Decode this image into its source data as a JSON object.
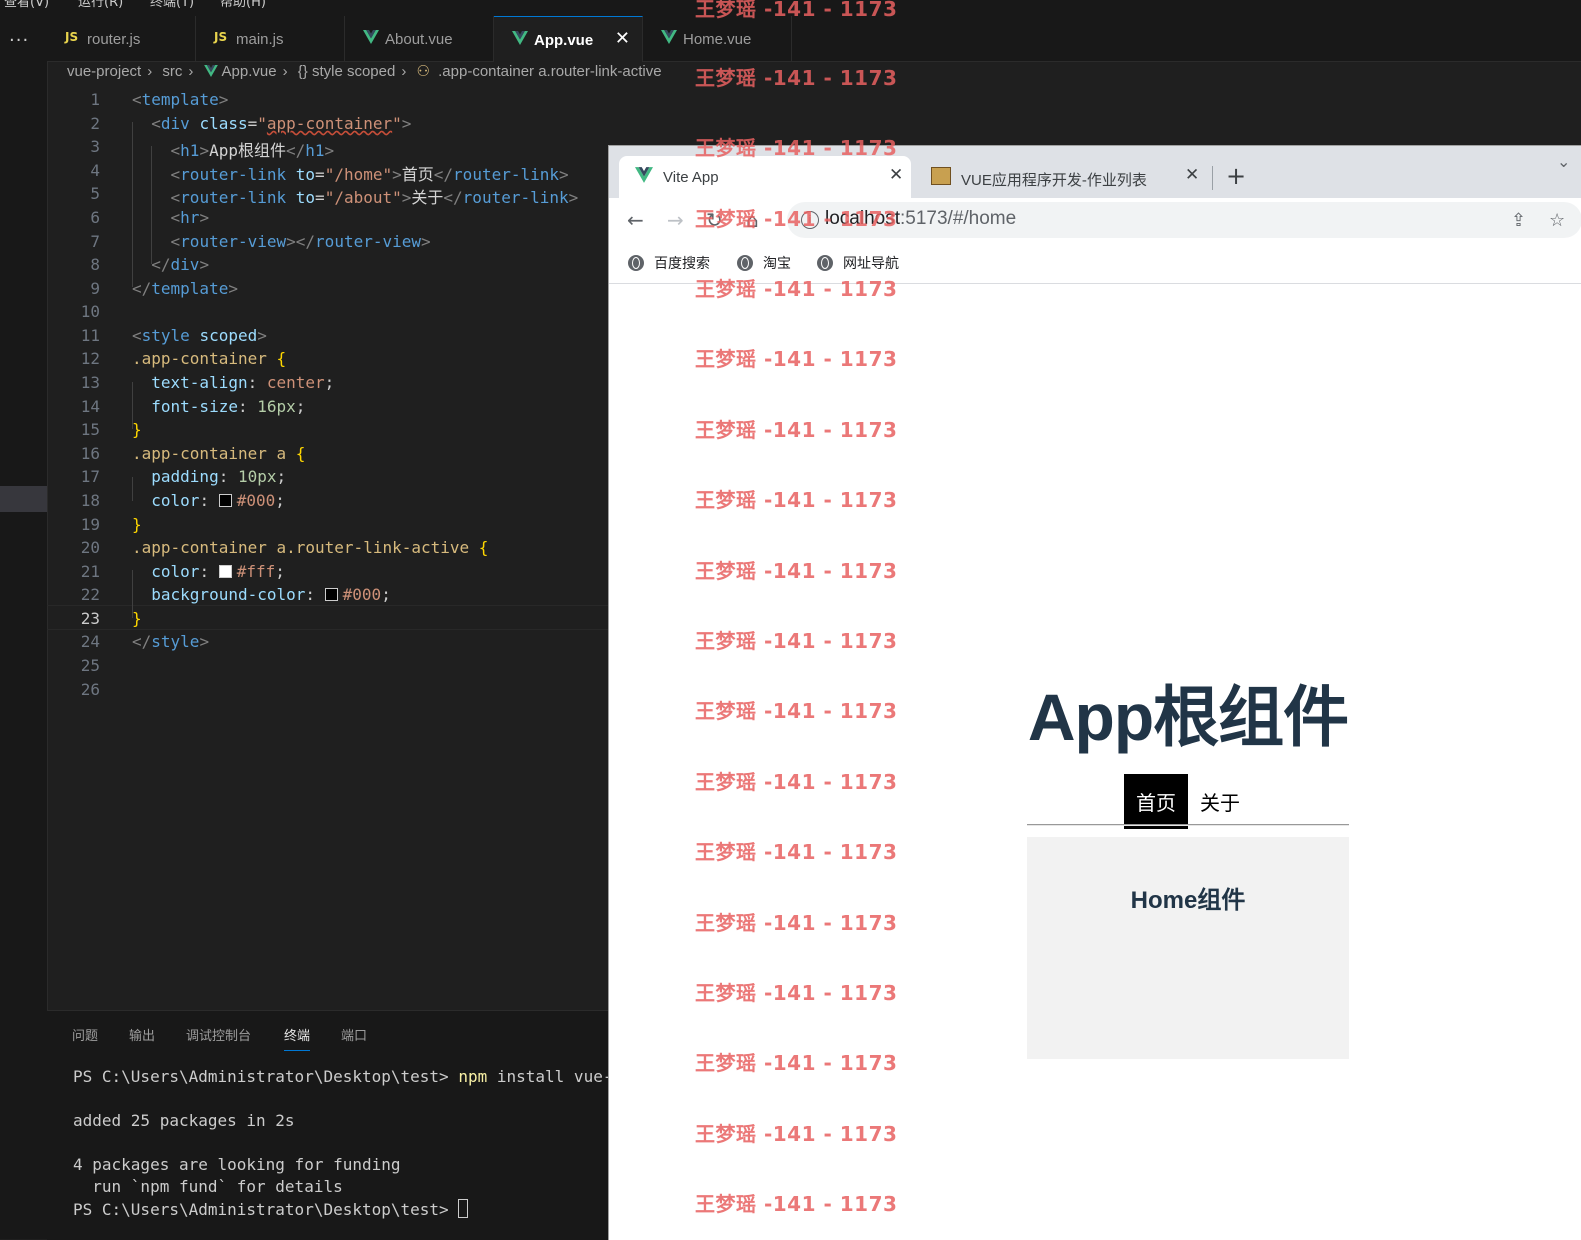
{
  "menubar": [
    "查看(V)",
    "运行(R)",
    "终端(T)",
    "帮助(H)"
  ],
  "activity": {
    "more": "···"
  },
  "editor_tabs": [
    {
      "icon": "JS",
      "label": "router.js"
    },
    {
      "icon": "JS",
      "label": "main.js"
    },
    {
      "icon": "vue",
      "label": "About.vue"
    },
    {
      "icon": "vue",
      "label": "App.vue",
      "active": true,
      "close": "✕"
    },
    {
      "icon": "vue",
      "label": "Home.vue"
    }
  ],
  "breadcrumb": [
    "vue-project",
    "src",
    "App.vue",
    "{} style scoped",
    ".app-container a.router-link-active"
  ],
  "code": {
    "current_line": 23,
    "line_count": 26
  },
  "panel": {
    "tabs": [
      "问题",
      "输出",
      "调试控制台",
      "终端",
      "端口"
    ],
    "active_tab": "终端",
    "terminal": {
      "prompt": "PS C:\\Users\\Administrator\\Desktop\\test>",
      "command": "npm",
      "command_rest": " install vue-router",
      "line2": "added 25 packages in 2s",
      "line3": "4 packages are looking for funding",
      "line4": "  run `npm fund` for details",
      "prompt2": "PS C:\\Users\\Administrator\\Desktop\\test>"
    }
  },
  "browser": {
    "tabs": [
      {
        "title": "Vite App",
        "active": true
      },
      {
        "title": "VUE应用程序开发-作业列表",
        "active": false
      }
    ],
    "new_tab": "+",
    "url_host": "localhost",
    "url_rest": ":5173/#/home",
    "bookmarks": [
      "百度搜索",
      "淘宝",
      "网址导航"
    ],
    "page": {
      "title": "App根组件",
      "links": [
        {
          "label": "首页",
          "active": true
        },
        {
          "label": "关于",
          "active": false
        }
      ],
      "home_heading": "Home组件"
    }
  },
  "watermark": "王梦瑶 -141 - 1173",
  "colors": {
    "accent": "#0078d4",
    "vue_green": "#42b883",
    "watermark": "#e86060",
    "page_text": "#213547"
  }
}
